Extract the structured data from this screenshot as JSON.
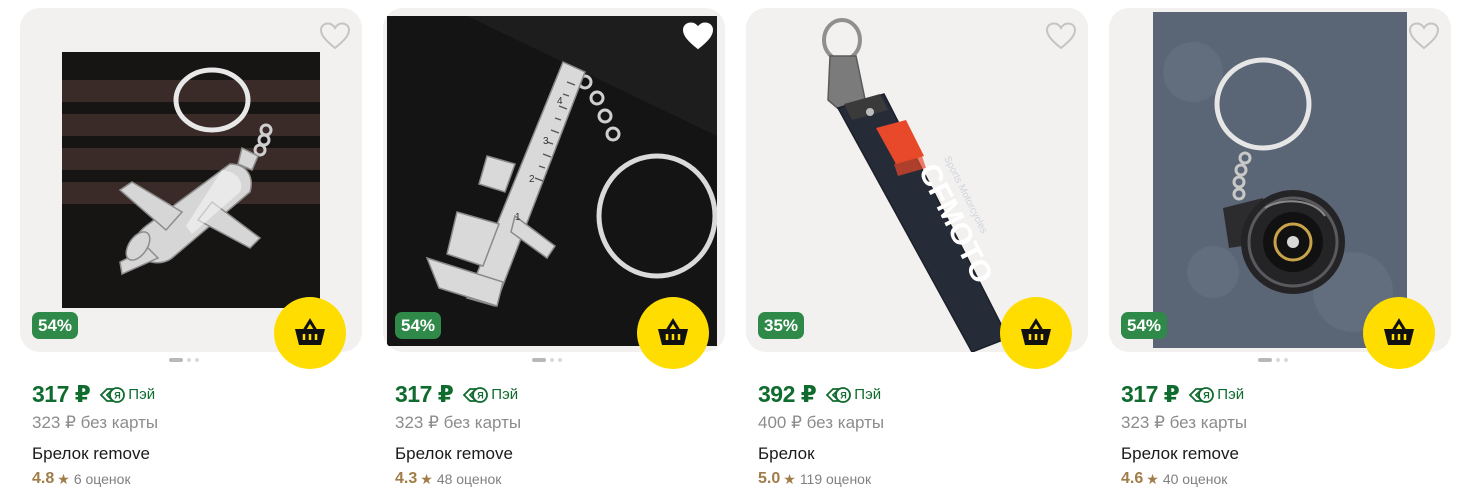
{
  "colors": {
    "price": "#0f6b2e",
    "discount_bg": "#2f8a4a",
    "cart_bg": "#ffdd00",
    "rating": "#a07d48"
  },
  "icons": {
    "favorite": "heart-icon",
    "cart": "basket-icon",
    "pay": "ya-pay-icon",
    "star": "star-icon"
  },
  "products": [
    {
      "discount": "54%",
      "price": "317 ₽",
      "pay_label": "Пэй",
      "old_price": "323 ₽ без карты",
      "title": "Брелок remove",
      "rating": "4.8",
      "star": "★",
      "reviews": "6 оценок",
      "image": "airplane-keychain",
      "favorite_filled": false
    },
    {
      "discount": "54%",
      "price": "317 ₽",
      "pay_label": "Пэй",
      "old_price": "323 ₽ без карты",
      "title": "Брелок remove",
      "rating": "4.3",
      "star": "★",
      "reviews": "48 оценок",
      "image": "caliper-keychain",
      "favorite_filled": true
    },
    {
      "discount": "35%",
      "price": "392 ₽",
      "pay_label": "Пэй",
      "old_price": "400 ₽ без карты",
      "title": "Брелок",
      "rating": "5.0",
      "star": "★",
      "reviews": "119 оценок",
      "image": "cfmoto-lanyard",
      "lanyard_text": "CFMOTO",
      "lanyard_subtext": "Sports Motorcycles",
      "favorite_filled": false
    },
    {
      "discount": "54%",
      "price": "317 ₽",
      "pay_label": "Пэй",
      "old_price": "323 ₽ без карты",
      "title": "Брелок remove",
      "rating": "4.6",
      "star": "★",
      "reviews": "40 оценок",
      "image": "turbo-keychain",
      "favorite_filled": false
    }
  ]
}
